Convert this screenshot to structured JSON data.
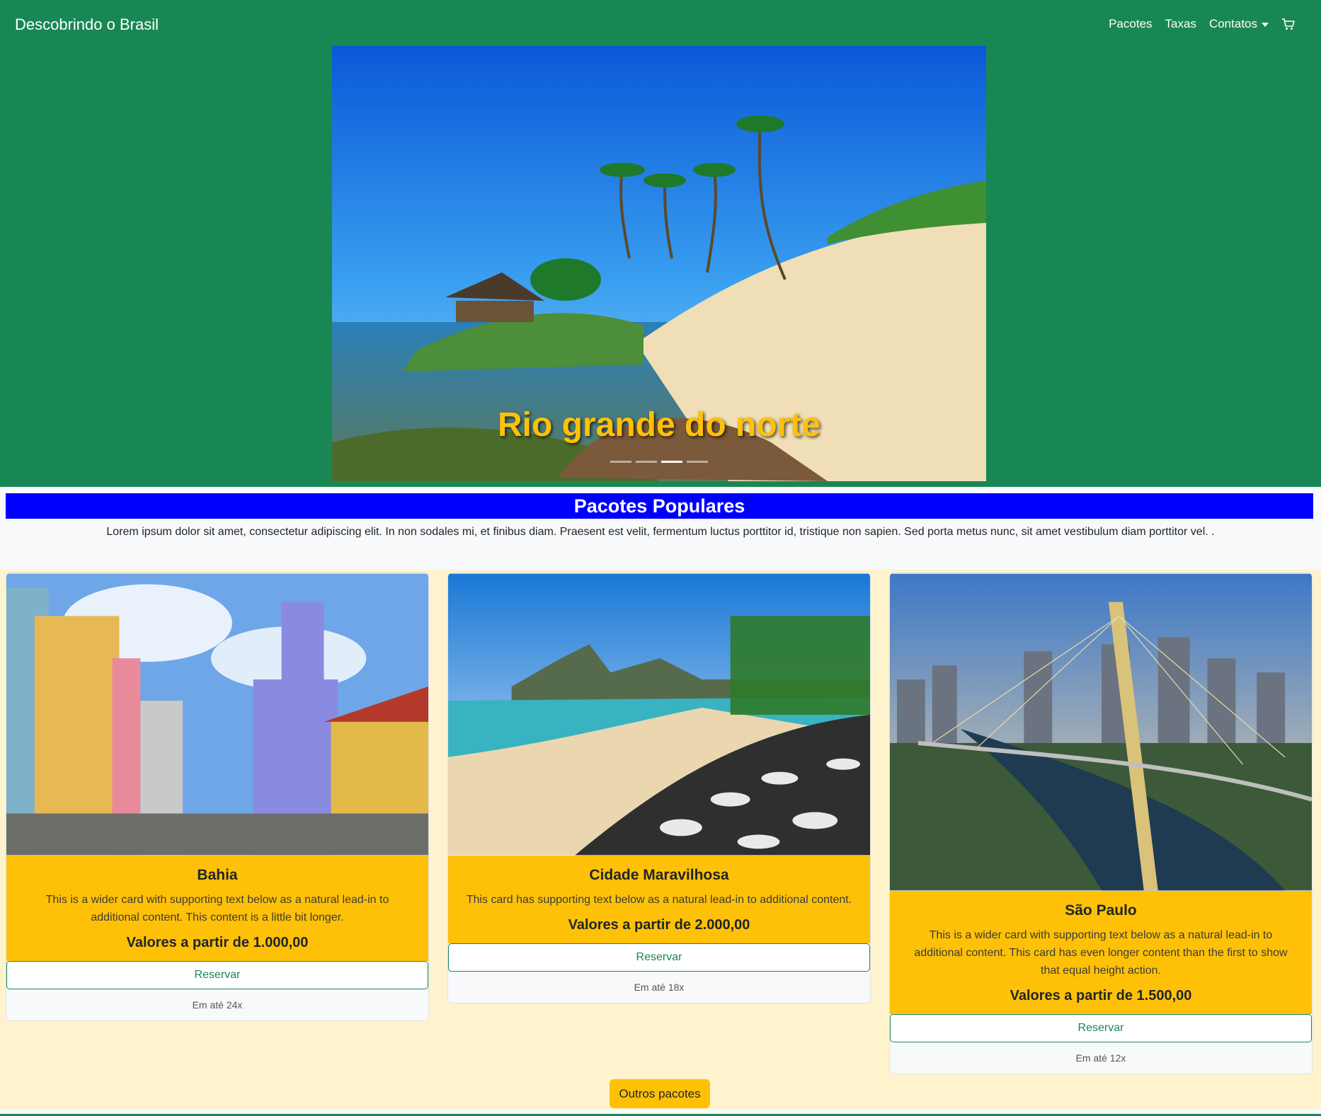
{
  "navbar": {
    "brand": "Descobrindo o Brasil",
    "links": [
      {
        "label": "Pacotes"
      },
      {
        "label": "Taxas"
      },
      {
        "label": "Contatos"
      }
    ],
    "cart_icon": "cart-icon",
    "colors": {
      "background": "#198754",
      "text": "#ffffff"
    }
  },
  "carousel": {
    "caption": "Rio grande do norte",
    "slides_count": 4,
    "active_slide": 3,
    "caption_color": "#ffc107"
  },
  "popular": {
    "title": "Pacotes Populares",
    "lead": "Lorem ipsum dolor sit amet, consectetur adipiscing elit. In non sodales mi, et finibus diam. Praesent est velit, fermentum luctus porttitor id, tristique non sapien. Sed porta metus nunc, sit amet vestibulum diam porttitor vel. .",
    "title_bg": "#0000ff",
    "cards": [
      {
        "title": "Bahia",
        "text": "This is a wider card with supporting text below as a natural lead-in to additional content. This content is a little bit longer.",
        "price": "Valores a partir de 1.000,00",
        "button": "Reservar",
        "footer": "Em até 24x"
      },
      {
        "title": "Cidade Maravilhosa",
        "text": "This card has supporting text below as a natural lead-in to additional content.",
        "price": "Valores a partir de 2.000,00",
        "button": "Reservar",
        "footer": "Em até 18x"
      },
      {
        "title": "São Paulo",
        "text": "This is a wider card with supporting text below as a natural lead-in to additional content. This card has even longer content than the first to show that equal height action.",
        "price": "Valores a partir de 1.500,00",
        "button": "Reservar",
        "footer": "Em até 12x"
      }
    ],
    "more_button": "Outros pacotes",
    "card_accent": "#ffc107"
  }
}
